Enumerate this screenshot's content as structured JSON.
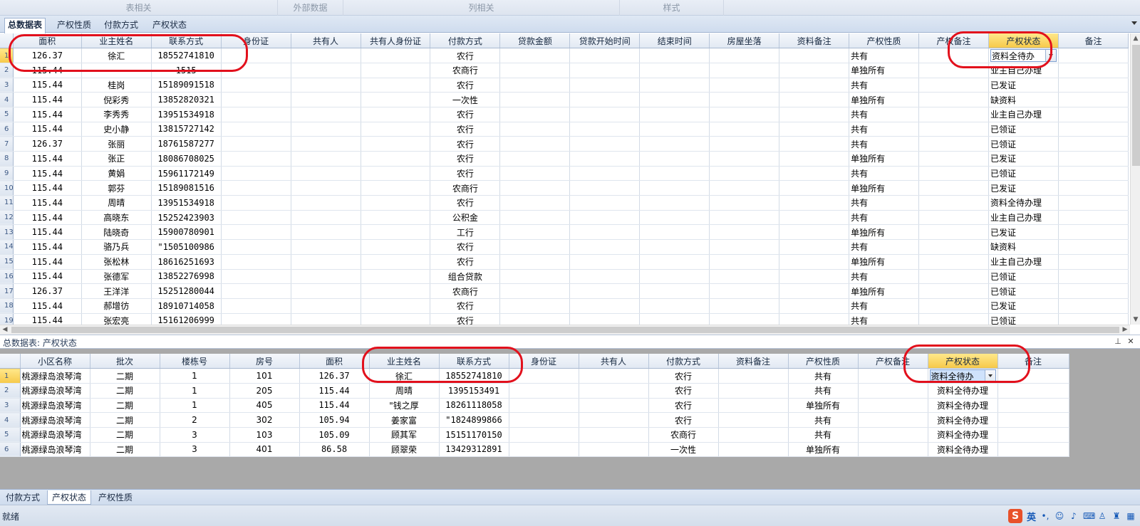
{
  "ribbon": {
    "groups": [
      "表相关",
      "外部数据",
      "列相关",
      "样式"
    ]
  },
  "top_tabs": [
    "总数据表",
    "产权性质",
    "付款方式",
    "产权状态"
  ],
  "upper_grid": {
    "columns": [
      "面积",
      "业主姓名",
      "联系方式",
      "身份证",
      "共有人",
      "共有人身份证",
      "付款方式",
      "贷款金额",
      "贷款开始时间",
      "结束时间",
      "房屋坐落",
      "资料备注",
      "产权性质",
      "产权备注",
      "产权状态",
      "备注"
    ],
    "rows": [
      {
        "n": "1",
        "area": "126.37",
        "name": "徐汇",
        "phone": "18552741810",
        "pay": "农行",
        "nature": "共有",
        "status": "资料全待办"
      },
      {
        "n": "2",
        "area": "115.44",
        "name": "",
        "phone": "1515",
        "pay": "农商行",
        "nature": "单独所有",
        "status": "业主自己办理"
      },
      {
        "n": "3",
        "area": "115.44",
        "name": "桂岗",
        "phone": "15189091518",
        "pay": "农行",
        "nature": "共有",
        "status": "已发证"
      },
      {
        "n": "4",
        "area": "115.44",
        "name": "倪彩秀",
        "phone": "13852820321",
        "pay": "一次性",
        "nature": "单独所有",
        "status": "缺资料"
      },
      {
        "n": "5",
        "area": "115.44",
        "name": "李秀秀",
        "phone": "13951534918",
        "pay": "农行",
        "nature": "共有",
        "status": "业主自己办理"
      },
      {
        "n": "6",
        "area": "115.44",
        "name": "史小静",
        "phone": "13815727142",
        "pay": "农行",
        "nature": "共有",
        "status": "已领证"
      },
      {
        "n": "7",
        "area": "126.37",
        "name": "张丽",
        "phone": "18761587277",
        "pay": "农行",
        "nature": "共有",
        "status": "已领证"
      },
      {
        "n": "8",
        "area": "115.44",
        "name": "张正",
        "phone": "18086708025",
        "pay": "农行",
        "nature": "单独所有",
        "status": "已发证"
      },
      {
        "n": "9",
        "area": "115.44",
        "name": "黄娟",
        "phone": "15961172149",
        "pay": "农行",
        "nature": "共有",
        "status": "已领证"
      },
      {
        "n": "10",
        "area": "115.44",
        "name": "郭芬",
        "phone": "15189081516",
        "pay": "农商行",
        "nature": "单独所有",
        "status": "已发证"
      },
      {
        "n": "11",
        "area": "115.44",
        "name": "周晴",
        "phone": "13951534918",
        "pay": "农行",
        "nature": "共有",
        "status": "资料全待办理"
      },
      {
        "n": "12",
        "area": "115.44",
        "name": "高晓东",
        "phone": "15252423903",
        "pay": "公积金",
        "nature": "共有",
        "status": "业主自己办理"
      },
      {
        "n": "13",
        "area": "115.44",
        "name": "陆晓奇",
        "phone": "15900780901",
        "pay": "工行",
        "nature": "单独所有",
        "status": "已发证"
      },
      {
        "n": "14",
        "area": "115.44",
        "name": "骆乃兵",
        "phone": "\"1505100986",
        "pay": "农行",
        "nature": "共有",
        "status": "缺资料"
      },
      {
        "n": "15",
        "area": "115.44",
        "name": "张松林",
        "phone": "18616251693",
        "pay": "农行",
        "nature": "单独所有",
        "status": "业主自己办理"
      },
      {
        "n": "16",
        "area": "115.44",
        "name": "张德军",
        "phone": "13852276998",
        "pay": "组合贷款",
        "nature": "共有",
        "status": "已领证"
      },
      {
        "n": "17",
        "area": "126.37",
        "name": "王洋洋",
        "phone": "15251280044",
        "pay": "农商行",
        "nature": "单独所有",
        "status": "已领证"
      },
      {
        "n": "18",
        "area": "115.44",
        "name": "郝增彷",
        "phone": "18910714058",
        "pay": "农行",
        "nature": "共有",
        "status": "已发证"
      },
      {
        "n": "19",
        "area": "115.44",
        "name": "张宏亮",
        "phone": "15161206999",
        "pay": "农行",
        "nature": "共有",
        "status": "已领证"
      }
    ]
  },
  "panel": {
    "title": "总数据表: 产权状态"
  },
  "lower_grid": {
    "columns": [
      "小区名称",
      "批次",
      "楼栋号",
      "房号",
      "面积",
      "业主姓名",
      "联系方式",
      "身份证",
      "共有人",
      "付款方式",
      "资料备注",
      "产权性质",
      "产权备注",
      "产权状态",
      "备注"
    ],
    "rows": [
      {
        "n": "1",
        "community": "桃源绿岛浪琴湾",
        "batch": "二期",
        "bldg": "1",
        "room": "101",
        "area": "126.37",
        "name": "徐汇",
        "phone": "18552741810",
        "pay": "农行",
        "nature": "共有",
        "status": "资料全待办"
      },
      {
        "n": "2",
        "community": "桃源绿岛浪琴湾",
        "batch": "二期",
        "bldg": "1",
        "room": "205",
        "area": "115.44",
        "name": "周晴",
        "phone": "1395153491",
        "pay": "农行",
        "nature": "共有",
        "status": "资料全待办理"
      },
      {
        "n": "3",
        "community": "桃源绿岛浪琴湾",
        "batch": "二期",
        "bldg": "1",
        "room": "405",
        "area": "115.44",
        "name": "\"钱之厚",
        "phone": "18261118058",
        "pay": "农行",
        "nature": "单独所有",
        "status": "资料全待办理"
      },
      {
        "n": "4",
        "community": "桃源绿岛浪琴湾",
        "batch": "二期",
        "bldg": "2",
        "room": "302",
        "area": "105.94",
        "name": "姜家富",
        "phone": "\"1824899866",
        "pay": "农行",
        "nature": "共有",
        "status": "资料全待办理"
      },
      {
        "n": "5",
        "community": "桃源绿岛浪琴湾",
        "batch": "二期",
        "bldg": "3",
        "room": "103",
        "area": "105.09",
        "name": "顾其军",
        "phone": "15151170150",
        "pay": "农商行",
        "nature": "共有",
        "status": "资料全待办理"
      },
      {
        "n": "6",
        "community": "桃源绿岛浪琴湾",
        "batch": "二期",
        "bldg": "3",
        "room": "401",
        "area": "86.58",
        "name": "顾翠荣",
        "phone": "13429312891",
        "pay": "一次性",
        "nature": "单独所有",
        "status": "资料全待办理"
      }
    ]
  },
  "sheet_tabs": [
    "付款方式",
    "产权状态",
    "产权性质"
  ],
  "status": {
    "text": "就绪"
  },
  "ime": {
    "logo": "S",
    "lang": "英"
  },
  "colors": {
    "header_highlight": "#f6c94a",
    "annotation": "#e2101c",
    "selected_cell": "#cfe2fb"
  }
}
